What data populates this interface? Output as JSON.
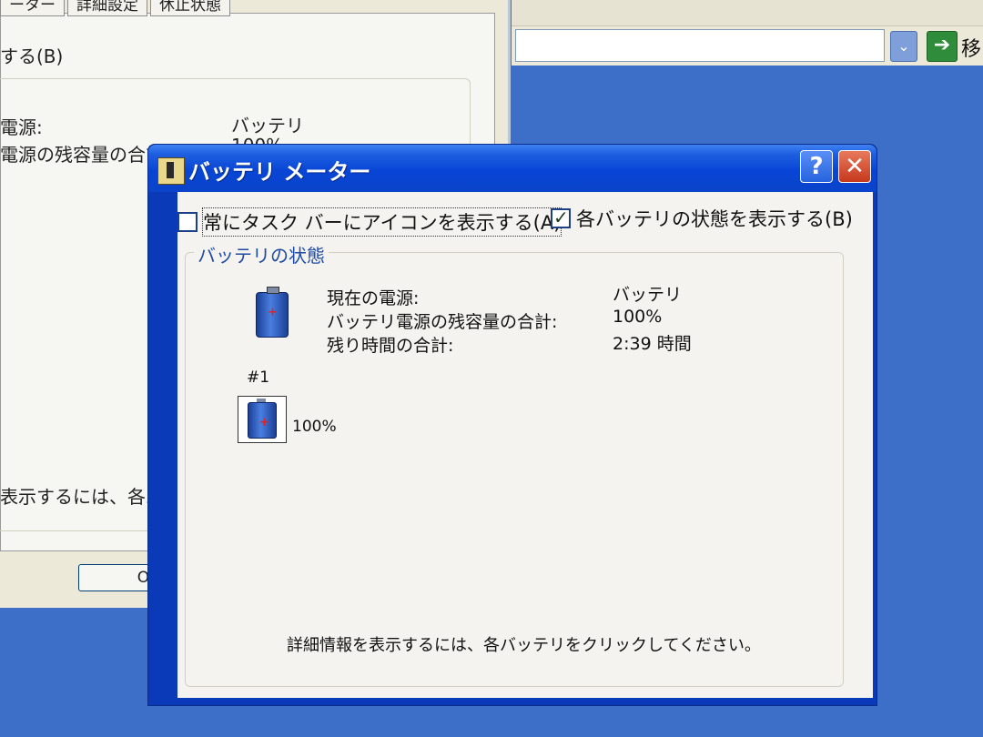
{
  "background_window": {
    "tabs": [
      "ーター",
      "詳細設定",
      "休止状態"
    ],
    "checkbox_fragment": "する(B)",
    "power_source_label": "電源:",
    "power_source_value": "バッテリ",
    "remaining_label": "電源の残容量の合計",
    "remaining_value": "100%",
    "hint_fragment": "表示するには、各バッテ",
    "ok_label": "OK"
  },
  "address_bar": {
    "dropdown_icon": "chevron-down-icon",
    "go_icon": "arrow-right-icon",
    "go_label": "移"
  },
  "dialog": {
    "title": "バッテリ メーター",
    "help_label": "?",
    "close_label": "✕",
    "options": {
      "taskbar_icon_label": "常にタスク バーにアイコンを表示する(A)",
      "taskbar_icon_checked": false,
      "show_each_label": "各バッテリの状態を表示する(B)",
      "show_each_checked": true
    },
    "group_title": "バッテリの状態",
    "status": {
      "power_source_label": "現在の電源:",
      "power_source_value": "バッテリ",
      "total_remaining_label": "バッテリ電源の残容量の合計:",
      "total_remaining_value": "100%",
      "total_time_label": "残り時間の合計:",
      "total_time_value": "2:39 時間"
    },
    "batteries": [
      {
        "label": "#1",
        "percent_text": "100%",
        "level": 1.0
      }
    ],
    "hint": "詳細情報を表示するには、各バッテリをクリックしてください。"
  },
  "colors": {
    "title_bar": "#0845d6",
    "close_button": "#c6381c",
    "group_title": "#1f4aa5",
    "desktop": "#3e6fc8"
  }
}
